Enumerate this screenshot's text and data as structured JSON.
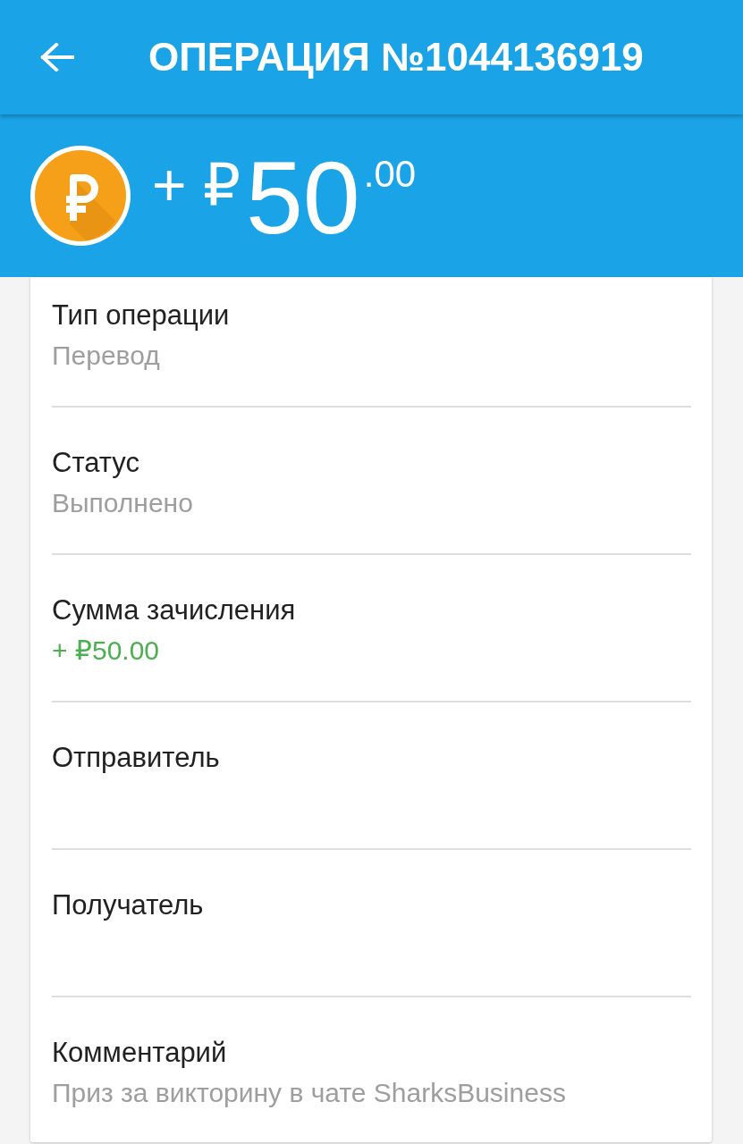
{
  "toolbar": {
    "title": "ОПЕРАЦИЯ №1044136919"
  },
  "amount_banner": {
    "sign": "+ ₽",
    "whole": "50",
    "fraction": ".00"
  },
  "details": [
    {
      "label": "Тип операции",
      "value": "Перевод",
      "kind": "text"
    },
    {
      "label": "Статус",
      "value": "Выполнено",
      "kind": "text"
    },
    {
      "label": "Сумма зачисления",
      "value": "+ ₽50.00",
      "kind": "credit"
    },
    {
      "label": "Отправитель",
      "kind": "blank"
    },
    {
      "label": "Получатель",
      "kind": "blank"
    },
    {
      "label": "Комментарий",
      "value": "Приз за викторину в чате SharksBusiness",
      "kind": "text"
    }
  ]
}
